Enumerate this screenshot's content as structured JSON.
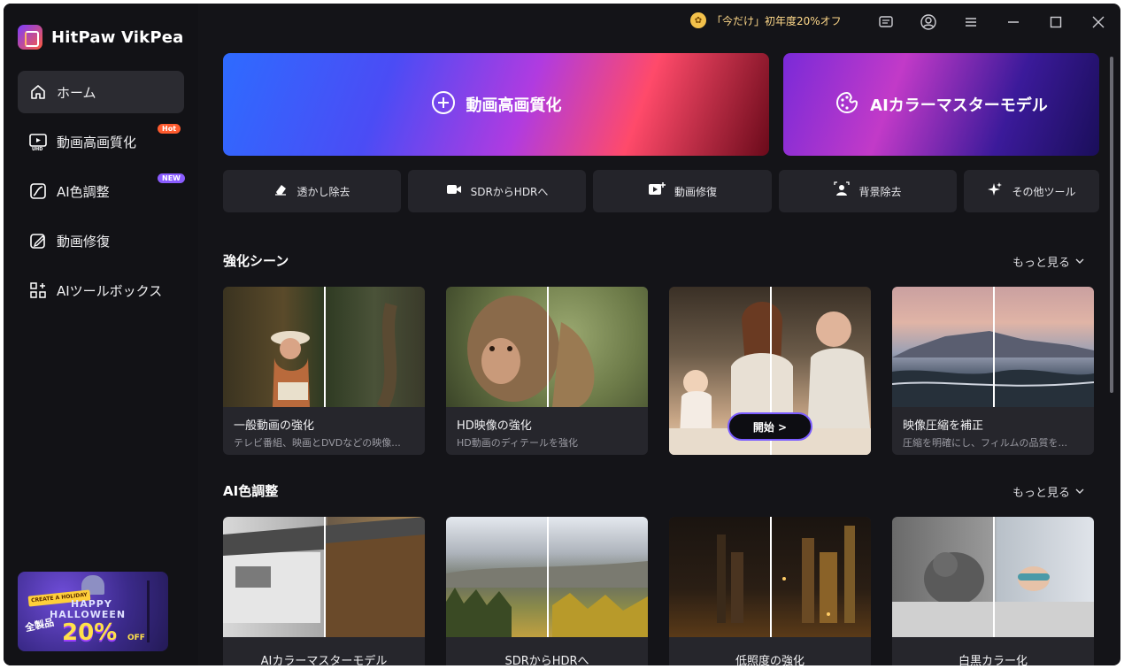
{
  "app": {
    "name": "HitPaw VikPea"
  },
  "sidebar": {
    "items": [
      {
        "label": "ホーム",
        "icon": "home-icon",
        "active": true
      },
      {
        "label": "動画高画質化",
        "icon": "uhd-video-icon",
        "badge": "Hot"
      },
      {
        "label": "AI色調整",
        "icon": "color-curve-icon",
        "badge": "NEW"
      },
      {
        "label": "動画修復",
        "icon": "repair-icon"
      },
      {
        "label": "AIツールボックス",
        "icon": "toolbox-icon"
      }
    ],
    "promo": {
      "ribbon": "CREATE A HOLIDAY",
      "line1": "HAPPY",
      "line2": "HALLOWEEN",
      "tag": "全製品",
      "percent": "20%",
      "off": "OFF"
    }
  },
  "topbar": {
    "offer_text": "「今だけ」初年度20%オフ",
    "offer_icon": "gift-icon",
    "buttons": [
      "feedback-icon",
      "account-icon",
      "menu-icon",
      "minimize-icon",
      "maximize-icon",
      "close-icon"
    ]
  },
  "hero": {
    "primary_label": "動画高画質化",
    "secondary_label": "AIカラーマスターモデル"
  },
  "tools": [
    {
      "label": "透かし除去",
      "icon": "eraser-icon"
    },
    {
      "label": "SDRからHDRへ",
      "icon": "camera-icon"
    },
    {
      "label": "動画修復",
      "icon": "video-add-icon"
    },
    {
      "label": "背景除去",
      "icon": "person-bg-icon"
    },
    {
      "label": "その他ツール",
      "icon": "sparkle-icon"
    }
  ],
  "sections": {
    "enhance": {
      "title": "強化シーン",
      "more": "もっと見る",
      "cards": [
        {
          "title": "一般動画の強化",
          "desc": "テレビ番組、映画とDVDなどの映像..."
        },
        {
          "title": "HD映像の強化",
          "desc": "HD動画のディテールを強化"
        },
        {
          "title": "",
          "desc": "",
          "start": "開始 >"
        },
        {
          "title": "映像圧縮を補正",
          "desc": "圧縮を明確にし、フィルムの品質を..."
        }
      ]
    },
    "color": {
      "title": "AI色調整",
      "more": "もっと見る",
      "cards": [
        {
          "title": "AIカラーマスターモデル"
        },
        {
          "title": "SDRからHDRへ"
        },
        {
          "title": "低照度の強化"
        },
        {
          "title": "白黒カラー化"
        }
      ]
    }
  },
  "colors": {
    "accent": "#7a5cff",
    "hot": "#ff5b2e",
    "new": "#8a5cff",
    "bg": "#141418"
  }
}
